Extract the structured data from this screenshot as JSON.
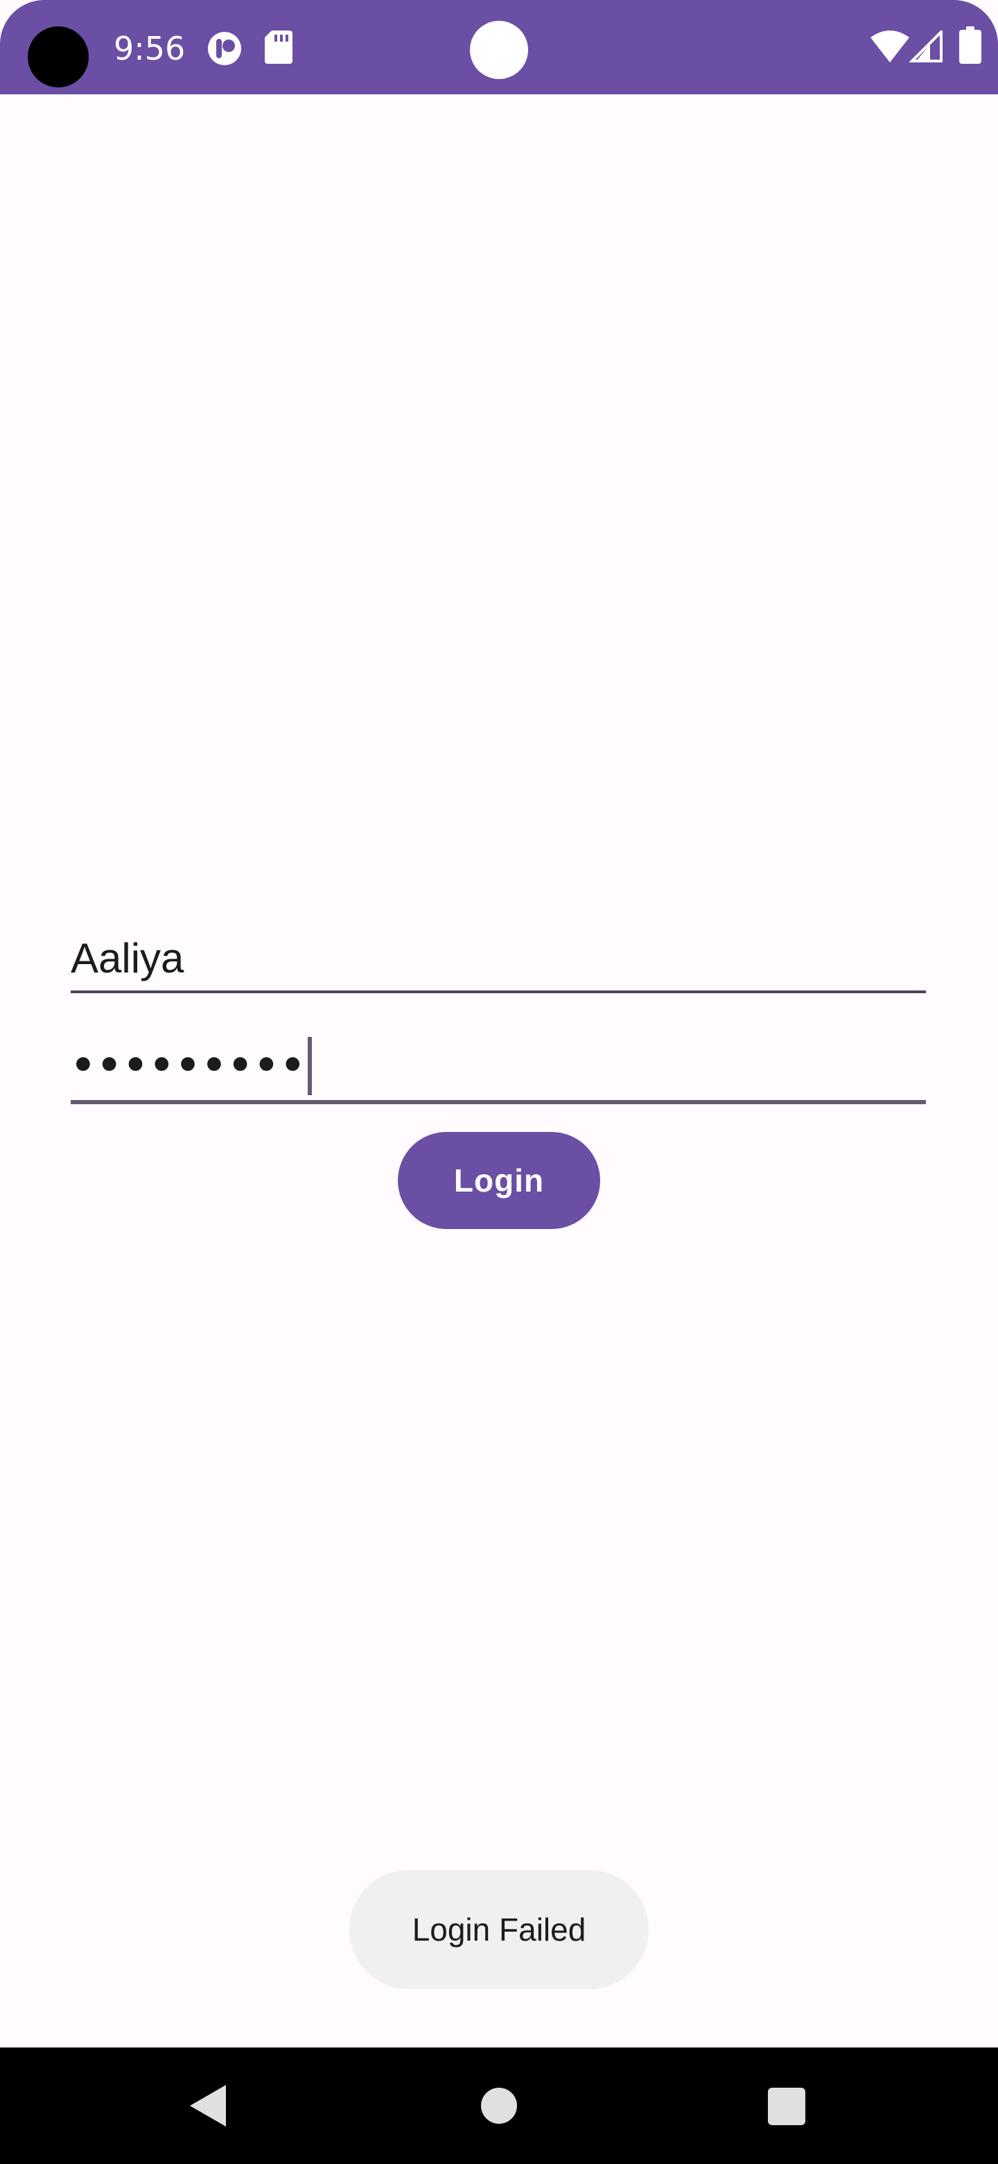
{
  "status_bar": {
    "time": "9:56",
    "icons": [
      "notification-app-icon",
      "sd-card-icon",
      "wifi-icon",
      "signal-icon",
      "battery-icon"
    ],
    "color": "#6a4fa4"
  },
  "login_form": {
    "username_value": "Aaliya",
    "password_masked": "•••••••••",
    "login_label": "Login",
    "accent_color": "#6a4fa4"
  },
  "toast": {
    "message": "Login Failed"
  },
  "nav_bar": {
    "buttons": [
      "back-icon",
      "home-icon",
      "recents-icon"
    ]
  }
}
